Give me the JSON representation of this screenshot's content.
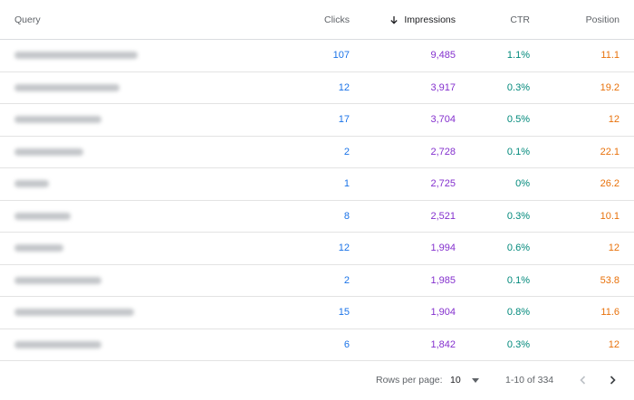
{
  "header": {
    "query": "Query",
    "clicks": "Clicks",
    "impressions": "Impressions",
    "ctr": "CTR",
    "position": "Position",
    "sort_icon": "arrow-down-icon"
  },
  "rows": [
    {
      "clicks": "107",
      "impressions": "9,485",
      "ctr": "1.1%",
      "position": "11.1"
    },
    {
      "clicks": "12",
      "impressions": "3,917",
      "ctr": "0.3%",
      "position": "19.2"
    },
    {
      "clicks": "17",
      "impressions": "3,704",
      "ctr": "0.5%",
      "position": "12"
    },
    {
      "clicks": "2",
      "impressions": "2,728",
      "ctr": "0.1%",
      "position": "22.1"
    },
    {
      "clicks": "1",
      "impressions": "2,725",
      "ctr": "0%",
      "position": "26.2"
    },
    {
      "clicks": "8",
      "impressions": "2,521",
      "ctr": "0.3%",
      "position": "10.1"
    },
    {
      "clicks": "12",
      "impressions": "1,994",
      "ctr": "0.6%",
      "position": "12"
    },
    {
      "clicks": "2",
      "impressions": "1,985",
      "ctr": "0.1%",
      "position": "53.8"
    },
    {
      "clicks": "15",
      "impressions": "1,904",
      "ctr": "0.8%",
      "position": "11.6"
    },
    {
      "clicks": "6",
      "impressions": "1,842",
      "ctr": "0.3%",
      "position": "12"
    }
  ],
  "footer": {
    "rows_per_page_label": "Rows per page:",
    "rows_per_page_value": "10",
    "range": "1-10 of 334",
    "prev_icon": "chevron-left-icon",
    "next_icon": "chevron-right-icon"
  },
  "colors": {
    "clicks": "#1a73e8",
    "impressions": "#8430ce",
    "ctr": "#00897b",
    "position": "#e8710a"
  }
}
